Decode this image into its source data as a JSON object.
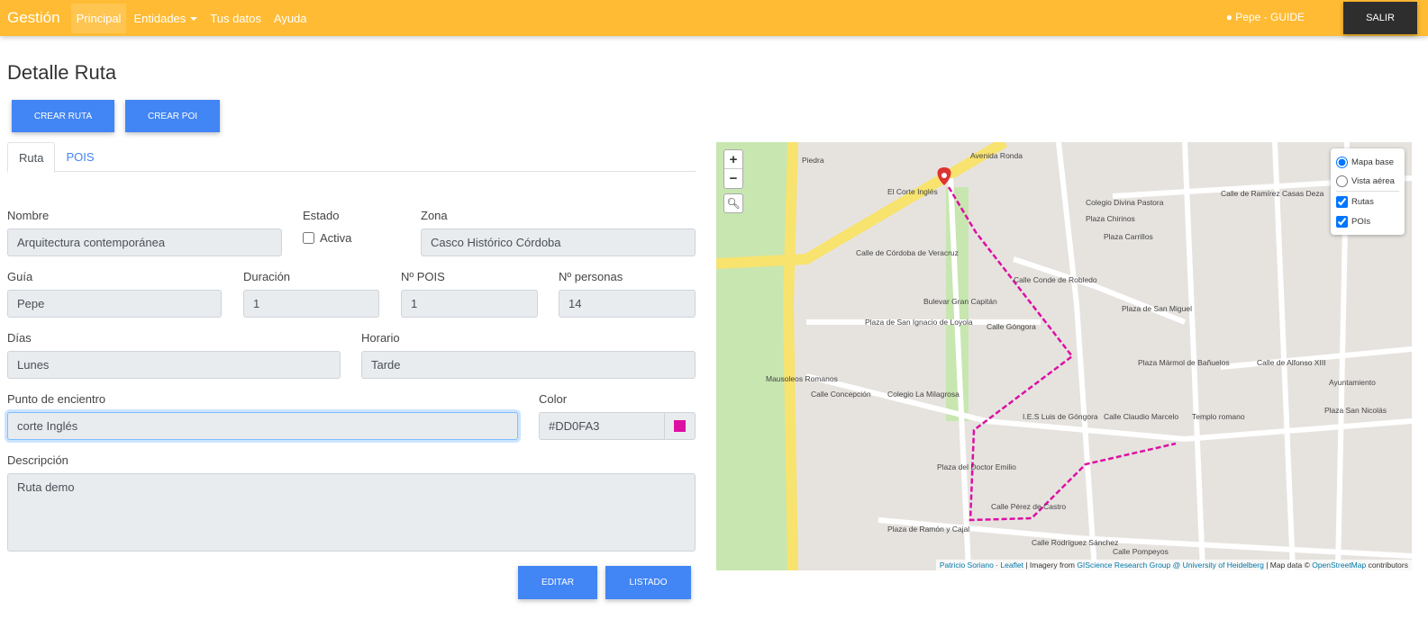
{
  "nav": {
    "brand": "Gestión",
    "items": [
      "Principal",
      "Entidades",
      "Tus datos",
      "Ayuda"
    ],
    "user": "Pepe - GUIDE",
    "logout": "SALIR"
  },
  "page": {
    "title": "Detalle Ruta",
    "create_route": "CREAR RUTA",
    "create_poi": "CREAR POI"
  },
  "tabs": [
    "Ruta",
    "POIS"
  ],
  "form": {
    "nombre_label": "Nombre",
    "nombre": "Arquitectura contemporánea",
    "estado_label": "Estado",
    "activa_label": "Activa",
    "activa": false,
    "zona_label": "Zona",
    "zona": "Casco Histórico Córdoba",
    "guia_label": "Guía",
    "guia": "Pepe",
    "duracion_label": "Duración",
    "duracion": "1",
    "npois_label": "Nº POIS",
    "npois": "1",
    "npersonas_label": "Nº personas",
    "npersonas": "14",
    "dias_label": "Días",
    "dias": "Lunes",
    "horario_label": "Horario",
    "horario": "Tarde",
    "punto_label": "Punto de encientro",
    "punto": "corte Inglés",
    "color_label": "Color",
    "color": "#DD0FA3",
    "descripcion_label": "Descripción",
    "descripcion": "Ruta demo"
  },
  "actions": {
    "edit": "EDITAR",
    "list": "LISTADO"
  },
  "map": {
    "zoom_in": "+",
    "zoom_out": "−",
    "layers": [
      "Mapa base",
      "Vista aérea",
      "Rutas",
      "POIs"
    ],
    "route_color": "#DD0FA3",
    "labels": [
      "Avenida Ronda",
      "El Corte Inglés",
      "Plaza Chirinos",
      "Colegio Divina Pastora",
      "Calle de Ramírez Casas Deza",
      "Plaza Carrillos",
      "Calle de Córdoba de Veracruz",
      "Calle Conde de Robledo",
      "Bulevar Gran Capitán",
      "Plaza de San Ignacio de Loyola",
      "Calle Góngora",
      "Plaza de San Miguel",
      "Plaza Mármol de Bañuelos",
      "Calle de Alfonso XIII",
      "Mausoleos Romanos",
      "Calle Concepción",
      "Colegio La Milagrosa",
      "I.E.S Luis de Góngora",
      "Calle Claudio Marcelo",
      "Templo romano",
      "Plaza San Nicolás",
      "Plaza del Doctor Emilio",
      "Calle Pérez de Castro",
      "Plaza de Ramón y Cajal",
      "Calle Rodríguez Sánchez",
      "Calle Pompeyos",
      "Piedra",
      "Ayuntamiento"
    ],
    "attribution": {
      "a": "Patricio Soriano",
      "b": "Leaflet",
      "c": " | Imagery from ",
      "d": "GIScience Research Group @ University of Heidelberg",
      "e": " | Map data © ",
      "f": "OpenStreetMap",
      "g": " contributors"
    }
  }
}
